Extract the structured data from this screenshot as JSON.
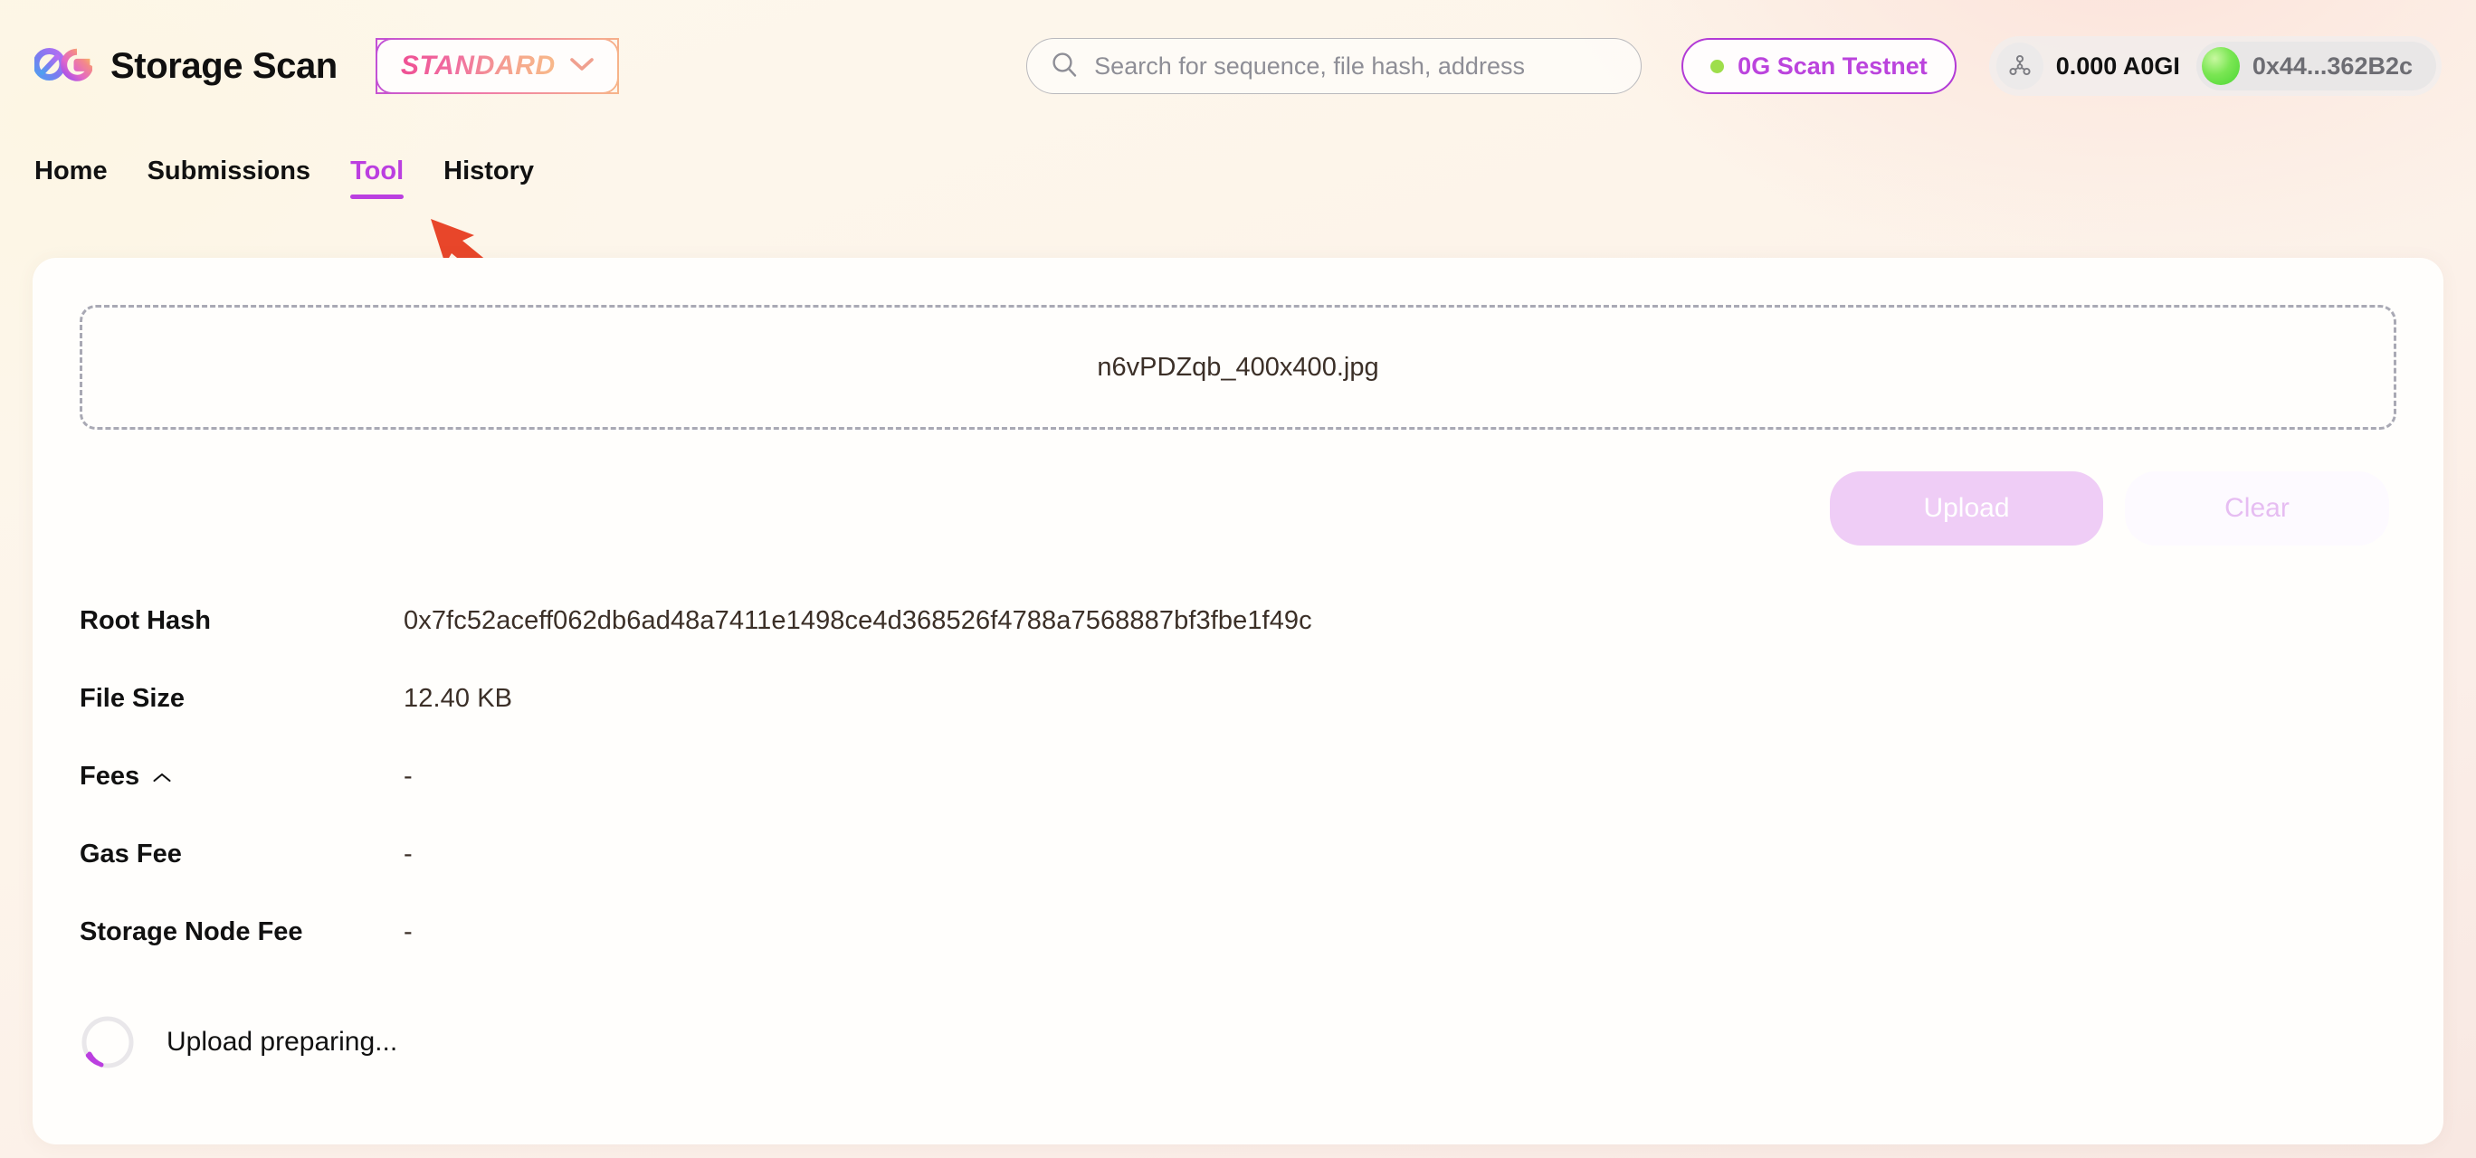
{
  "header": {
    "brand_title": "Storage Scan",
    "logo_icon": "0g-logo-icon",
    "tier": {
      "label": "STANDARD",
      "caret_icon": "chevron-down-icon"
    },
    "search": {
      "placeholder": "Search for sequence, file hash, address",
      "value": "",
      "icon": "search-icon"
    },
    "network": {
      "label": "0G Scan Testnet",
      "status_dot_color": "#9ede4b",
      "accent_color": "#bb44dd"
    },
    "wallet": {
      "network_icon": "network-nodes-icon",
      "balance": "0.000 A0GI",
      "address": "0x44...362B2c",
      "avatar_icon": "wallet-avatar-icon"
    }
  },
  "nav": {
    "items": [
      {
        "label": "Home",
        "active": false
      },
      {
        "label": "Submissions",
        "active": false
      },
      {
        "label": "Tool",
        "active": true
      },
      {
        "label": "History",
        "active": false
      }
    ],
    "active_color": "#bb3fe0"
  },
  "annotation": {
    "arrow_icon": "red-arrow-pointer",
    "color": "#e8462a",
    "points_to": "Tool"
  },
  "tool": {
    "dropzone": {
      "filename": "n6vPDZqb_400x400.jpg"
    },
    "actions": {
      "upload_label": "Upload",
      "upload_disabled": true,
      "clear_label": "Clear",
      "clear_disabled": true
    },
    "details": [
      {
        "label": "Root Hash",
        "value": "0x7fc52aceff062db6ad48a7411e1498ce4d368526f4788a7568887bf3fbe1f49c",
        "caret": false
      },
      {
        "label": "File Size",
        "value": "12.40 KB",
        "caret": false
      },
      {
        "label": "Fees",
        "value": "-",
        "caret": true
      },
      {
        "label": "Gas Fee",
        "value": "-",
        "caret": false
      },
      {
        "label": "Storage Node Fee",
        "value": "-",
        "caret": false
      }
    ],
    "status": {
      "text": "Upload preparing...",
      "spinner_icon": "loading-spinner-icon",
      "spinner_color": "#bb3fe0"
    }
  }
}
